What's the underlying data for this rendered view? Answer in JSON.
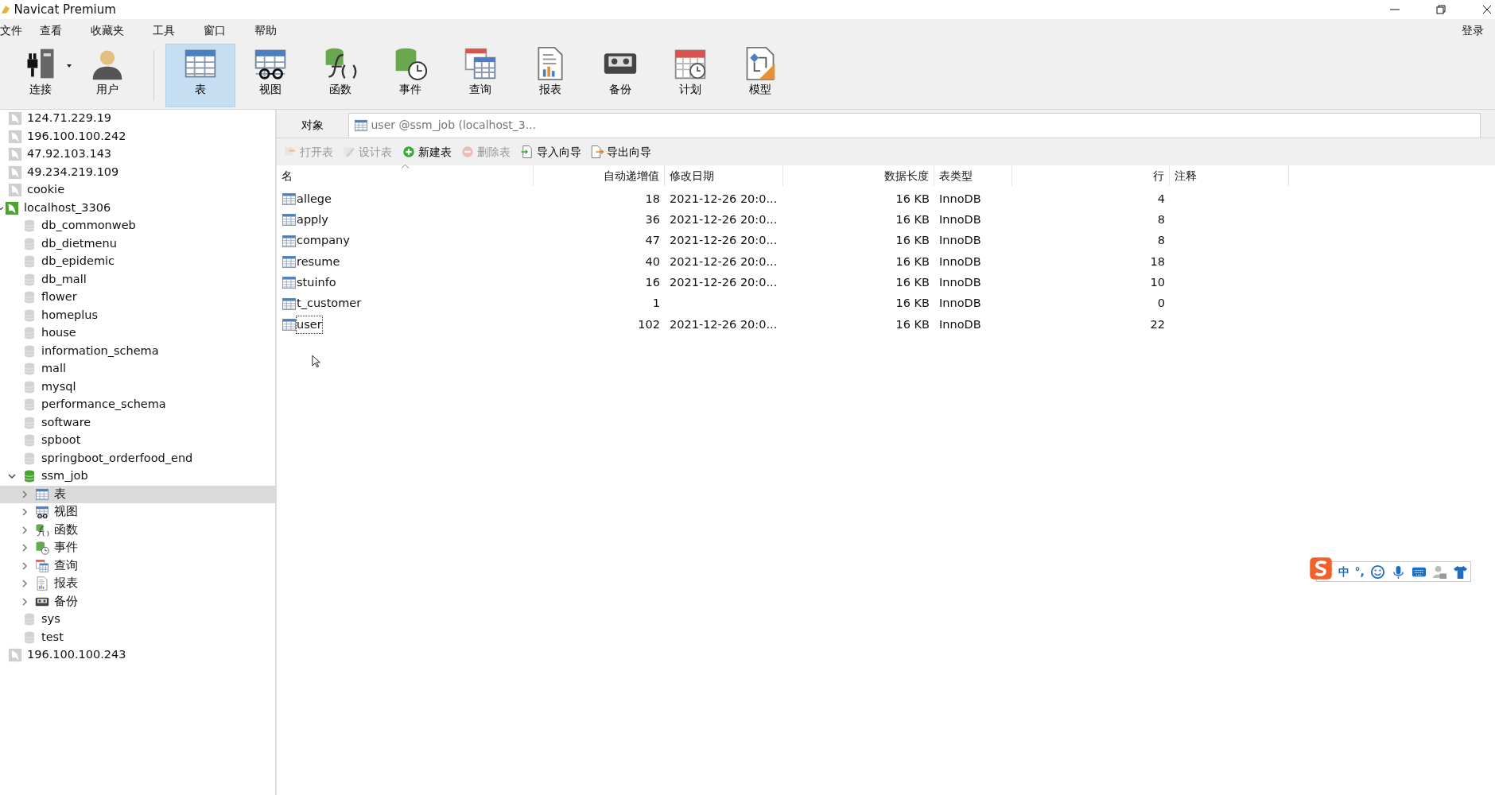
{
  "window": {
    "title": "Navicat Premium"
  },
  "menu": [
    "文件",
    "查看",
    "收藏夹",
    "工具",
    "窗口",
    "帮助"
  ],
  "login": "登录",
  "toolbar": [
    {
      "kind": "connection",
      "label": "连接",
      "selected": false,
      "dropdown": true
    },
    {
      "kind": "user",
      "label": "用户",
      "selected": false
    },
    {
      "kind": "table",
      "label": "表",
      "selected": true
    },
    {
      "kind": "view",
      "label": "视图",
      "selected": false
    },
    {
      "kind": "function",
      "label": "函数",
      "selected": false
    },
    {
      "kind": "event",
      "label": "事件",
      "selected": false
    },
    {
      "kind": "query",
      "label": "查询",
      "selected": false
    },
    {
      "kind": "report",
      "label": "报表",
      "selected": false
    },
    {
      "kind": "backup",
      "label": "备份",
      "selected": false
    },
    {
      "kind": "schedule",
      "label": "计划",
      "selected": false
    },
    {
      "kind": "model",
      "label": "模型",
      "selected": false
    }
  ],
  "tree": [
    {
      "kind": "connection",
      "label": "124.71.229.19",
      "open": false,
      "selected": false
    },
    {
      "kind": "connection",
      "label": "196.100.100.242",
      "open": false,
      "selected": false
    },
    {
      "kind": "connection",
      "label": "47.92.103.143",
      "open": false,
      "selected": false
    },
    {
      "kind": "connection",
      "label": "49.234.219.109",
      "open": false,
      "selected": false
    },
    {
      "kind": "connection",
      "label": "cookie",
      "open": false,
      "selected": false
    },
    {
      "kind": "connection",
      "label": "localhost_3306",
      "open": true,
      "selected": false,
      "expanded": true,
      "children": [
        {
          "kind": "database",
          "label": "db_commonweb",
          "open": false,
          "selected": false
        },
        {
          "kind": "database",
          "label": "db_dietmenu",
          "open": false,
          "selected": false
        },
        {
          "kind": "database",
          "label": "db_epidemic",
          "open": false,
          "selected": false
        },
        {
          "kind": "database",
          "label": "db_mall",
          "open": false,
          "selected": false
        },
        {
          "kind": "database",
          "label": "flower",
          "open": false,
          "selected": false
        },
        {
          "kind": "database",
          "label": "homeplus",
          "open": false,
          "selected": false
        },
        {
          "kind": "database",
          "label": "house",
          "open": false,
          "selected": false
        },
        {
          "kind": "database",
          "label": "information_schema",
          "open": false,
          "selected": false
        },
        {
          "kind": "database",
          "label": "mall",
          "open": false,
          "selected": false
        },
        {
          "kind": "database",
          "label": "mysql",
          "open": false,
          "selected": false
        },
        {
          "kind": "database",
          "label": "performance_schema",
          "open": false,
          "selected": false
        },
        {
          "kind": "database",
          "label": "software",
          "open": false,
          "selected": false
        },
        {
          "kind": "database",
          "label": "spboot",
          "open": false,
          "selected": false
        },
        {
          "kind": "database",
          "label": "springboot_orderfood_end",
          "open": false,
          "selected": false
        },
        {
          "kind": "database",
          "label": "ssm_job",
          "open": true,
          "selected": false,
          "expanded": true,
          "children": [
            {
              "kind": "table",
              "label": "表",
              "selected": true,
              "expanded": false
            },
            {
              "kind": "view",
              "label": "视图",
              "selected": false,
              "expanded": false
            },
            {
              "kind": "function",
              "label": "函数",
              "selected": false,
              "expanded": false
            },
            {
              "kind": "event",
              "label": "事件",
              "selected": false,
              "expanded": false
            },
            {
              "kind": "query",
              "label": "查询",
              "selected": false,
              "expanded": false
            },
            {
              "kind": "report",
              "label": "报表",
              "selected": false,
              "expanded": false
            },
            {
              "kind": "backup",
              "label": "备份",
              "selected": false,
              "expanded": false
            }
          ]
        },
        {
          "kind": "database",
          "label": "sys",
          "open": false,
          "selected": false
        },
        {
          "kind": "database",
          "label": "test",
          "open": false,
          "selected": false
        }
      ]
    },
    {
      "kind": "connection",
      "label": "196.100.100.243",
      "open": false,
      "selected": false
    }
  ],
  "tabs": [
    {
      "label": "对象",
      "selected": false
    },
    {
      "label": "user @ssm_job (localhost_3...",
      "selected": true
    }
  ],
  "actions": [
    {
      "kind": "open",
      "label": "打开表",
      "disabled": true
    },
    {
      "kind": "design",
      "label": "设计表",
      "disabled": true
    },
    {
      "kind": "new",
      "label": "新建表",
      "disabled": false
    },
    {
      "kind": "delete",
      "label": "删除表",
      "disabled": true
    },
    {
      "kind": "import",
      "label": "导入向导",
      "disabled": false
    },
    {
      "kind": "export",
      "label": "导出向导",
      "disabled": false
    }
  ],
  "table": {
    "columns": [
      {
        "label": "名",
        "sorted": true
      },
      {
        "label": "自动递增值",
        "sorted": false
      },
      {
        "label": "修改日期",
        "sorted": false
      },
      {
        "label": "数据长度",
        "sorted": false
      },
      {
        "label": "表类型",
        "sorted": false
      },
      {
        "label": "行",
        "sorted": false
      },
      {
        "label": "注释",
        "sorted": false
      }
    ],
    "rows": [
      {
        "name": "allege",
        "auto_increment": "18",
        "modified": "2021-12-26 20:0...",
        "data_length": "16 KB",
        "engine": "InnoDB",
        "rows": "4",
        "focused": false
      },
      {
        "name": "apply",
        "auto_increment": "36",
        "modified": "2021-12-26 20:0...",
        "data_length": "16 KB",
        "engine": "InnoDB",
        "rows": "8",
        "focused": false
      },
      {
        "name": "company",
        "auto_increment": "47",
        "modified": "2021-12-26 20:0...",
        "data_length": "16 KB",
        "engine": "InnoDB",
        "rows": "8",
        "focused": false
      },
      {
        "name": "resume",
        "auto_increment": "40",
        "modified": "2021-12-26 20:0...",
        "data_length": "16 KB",
        "engine": "InnoDB",
        "rows": "18",
        "focused": false
      },
      {
        "name": "stuinfo",
        "auto_increment": "16",
        "modified": "2021-12-26 20:0...",
        "data_length": "16 KB",
        "engine": "InnoDB",
        "rows": "10",
        "focused": false
      },
      {
        "name": "t_customer",
        "auto_increment": "1",
        "data_length": "16 KB",
        "engine": "InnoDB",
        "rows": "0",
        "focused": false
      },
      {
        "name": "user",
        "auto_increment": "102",
        "modified": "2021-12-26 20:0...",
        "data_length": "16 KB",
        "engine": "InnoDB",
        "rows": "22",
        "focused": true
      }
    ]
  },
  "ime_bar": {
    "mode": "中",
    "punctuation": "°,"
  }
}
